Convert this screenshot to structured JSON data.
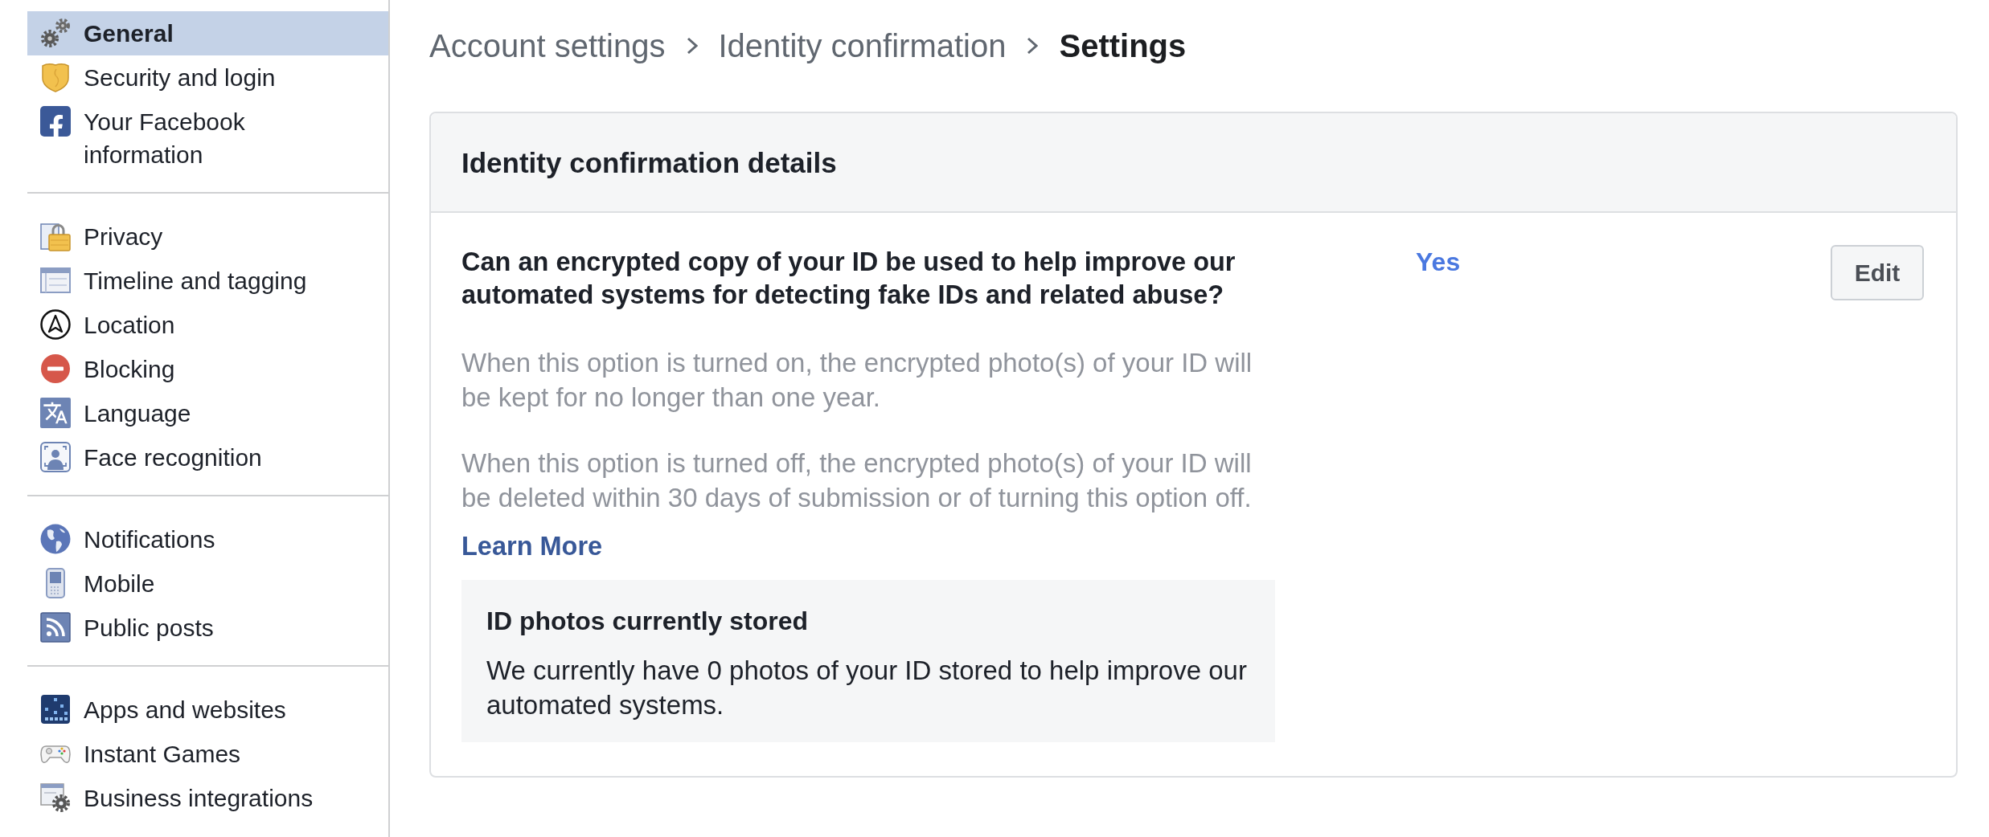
{
  "sidebar": {
    "groups": [
      {
        "items": [
          {
            "label": "General",
            "selected": true
          },
          {
            "label": "Security and login",
            "selected": false
          },
          {
            "label": "Your Facebook information",
            "selected": false
          }
        ]
      },
      {
        "items": [
          {
            "label": "Privacy",
            "selected": false
          },
          {
            "label": "Timeline and tagging",
            "selected": false
          },
          {
            "label": "Location",
            "selected": false
          },
          {
            "label": "Blocking",
            "selected": false
          },
          {
            "label": "Language",
            "selected": false
          },
          {
            "label": "Face recognition",
            "selected": false
          }
        ]
      },
      {
        "items": [
          {
            "label": "Notifications",
            "selected": false
          },
          {
            "label": "Mobile",
            "selected": false
          },
          {
            "label": "Public posts",
            "selected": false
          }
        ]
      },
      {
        "items": [
          {
            "label": "Apps and websites",
            "selected": false
          },
          {
            "label": "Instant Games",
            "selected": false
          },
          {
            "label": "Business integrations",
            "selected": false
          }
        ]
      }
    ]
  },
  "breadcrumb": [
    {
      "label": "Account settings",
      "current": false
    },
    {
      "label": "Identity confirmation",
      "current": false
    },
    {
      "label": "Settings",
      "current": true
    }
  ],
  "card": {
    "title": "Identity confirmation details",
    "setting": {
      "question": "Can an encrypted copy of your ID be used to help improve our automated systems for detecting fake IDs and related abuse?",
      "value": "Yes",
      "button": "Edit",
      "notes": [
        "When this option is turned on, the encrypted photo(s) of your ID will be kept for no longer than one year.",
        "When this option is turned off, the encrypted photo(s) of your ID will be deleted within 30 days of submission or of turning this option off."
      ],
      "link": "Learn More",
      "stored_photos": {
        "title": "ID photos currently stored",
        "text": "We currently have 0 photos of your ID stored to help improve our automated systems."
      }
    }
  }
}
